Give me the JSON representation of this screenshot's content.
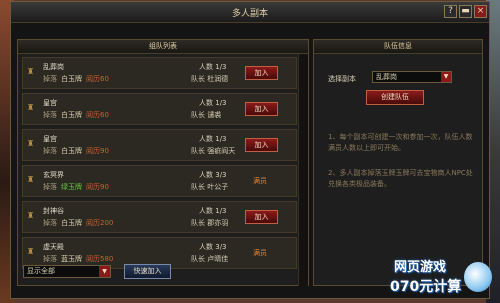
{
  "window": {
    "title": "多人副本",
    "help_icon": "?",
    "minimize_icon": "▬",
    "close_icon": "×"
  },
  "left_panel": {
    "title": "组队列表",
    "labels": {
      "drop": "掉落",
      "people": "人数",
      "leader": "队长"
    },
    "rows": [
      {
        "name": "乱葬岗",
        "dropbox": "白玉牌",
        "dropbox_color": "white",
        "rank": "阅历60",
        "count": "1/3",
        "leader": "杜润德",
        "action": "加入"
      },
      {
        "name": "皇宫",
        "dropbox": "白玉牌",
        "dropbox_color": "white",
        "rank": "阅历60",
        "count": "1/3",
        "leader": "谴裘",
        "action": "加入"
      },
      {
        "name": "皇宫",
        "dropbox": "白玉牌",
        "dropbox_color": "white",
        "rank": "阅历90",
        "count": "1/3",
        "leader": "强疵阎天",
        "action": "加入"
      },
      {
        "name": "玄冥界",
        "dropbox": "绿玉牌",
        "dropbox_color": "green",
        "rank": "阅历90",
        "count": "3/3",
        "leader": "叶公子",
        "action": "满员"
      },
      {
        "name": "封神谷",
        "dropbox": "白玉牌",
        "dropbox_color": "white",
        "rank": "阅历200",
        "count": "1/3",
        "leader": "郡亦羽",
        "action": "加入"
      },
      {
        "name": "虚天殿",
        "dropbox": "蓝玉牌",
        "dropbox_color": "white",
        "rank": "阅历580",
        "count": "3/3",
        "leader": "卢晴佳",
        "action": "满员"
      }
    ],
    "filter": {
      "value": "显示全部",
      "arrow": "▼"
    },
    "quick_join": "快速加入"
  },
  "right_panel": {
    "title": "队伍信息",
    "select_label": "选择副本",
    "select_value": "乱葬岗",
    "select_arrow": "▼",
    "create_button": "创建队伍",
    "tips": [
      "1、每个副本可创建一次和参加一次，队伍人数满员人数以上即可开始。",
      "2、多人副本掉落玉牌玉牌可去宝物商人NPC处兑换各类极品装备。"
    ]
  },
  "watermark": {
    "line1": "网页游戏",
    "line2": "070元计算"
  },
  "colors": {
    "accent_red": "#8a1a1a",
    "green_text": "#60c840",
    "orange_rank": "#d06030",
    "full_text": "#e08030"
  }
}
